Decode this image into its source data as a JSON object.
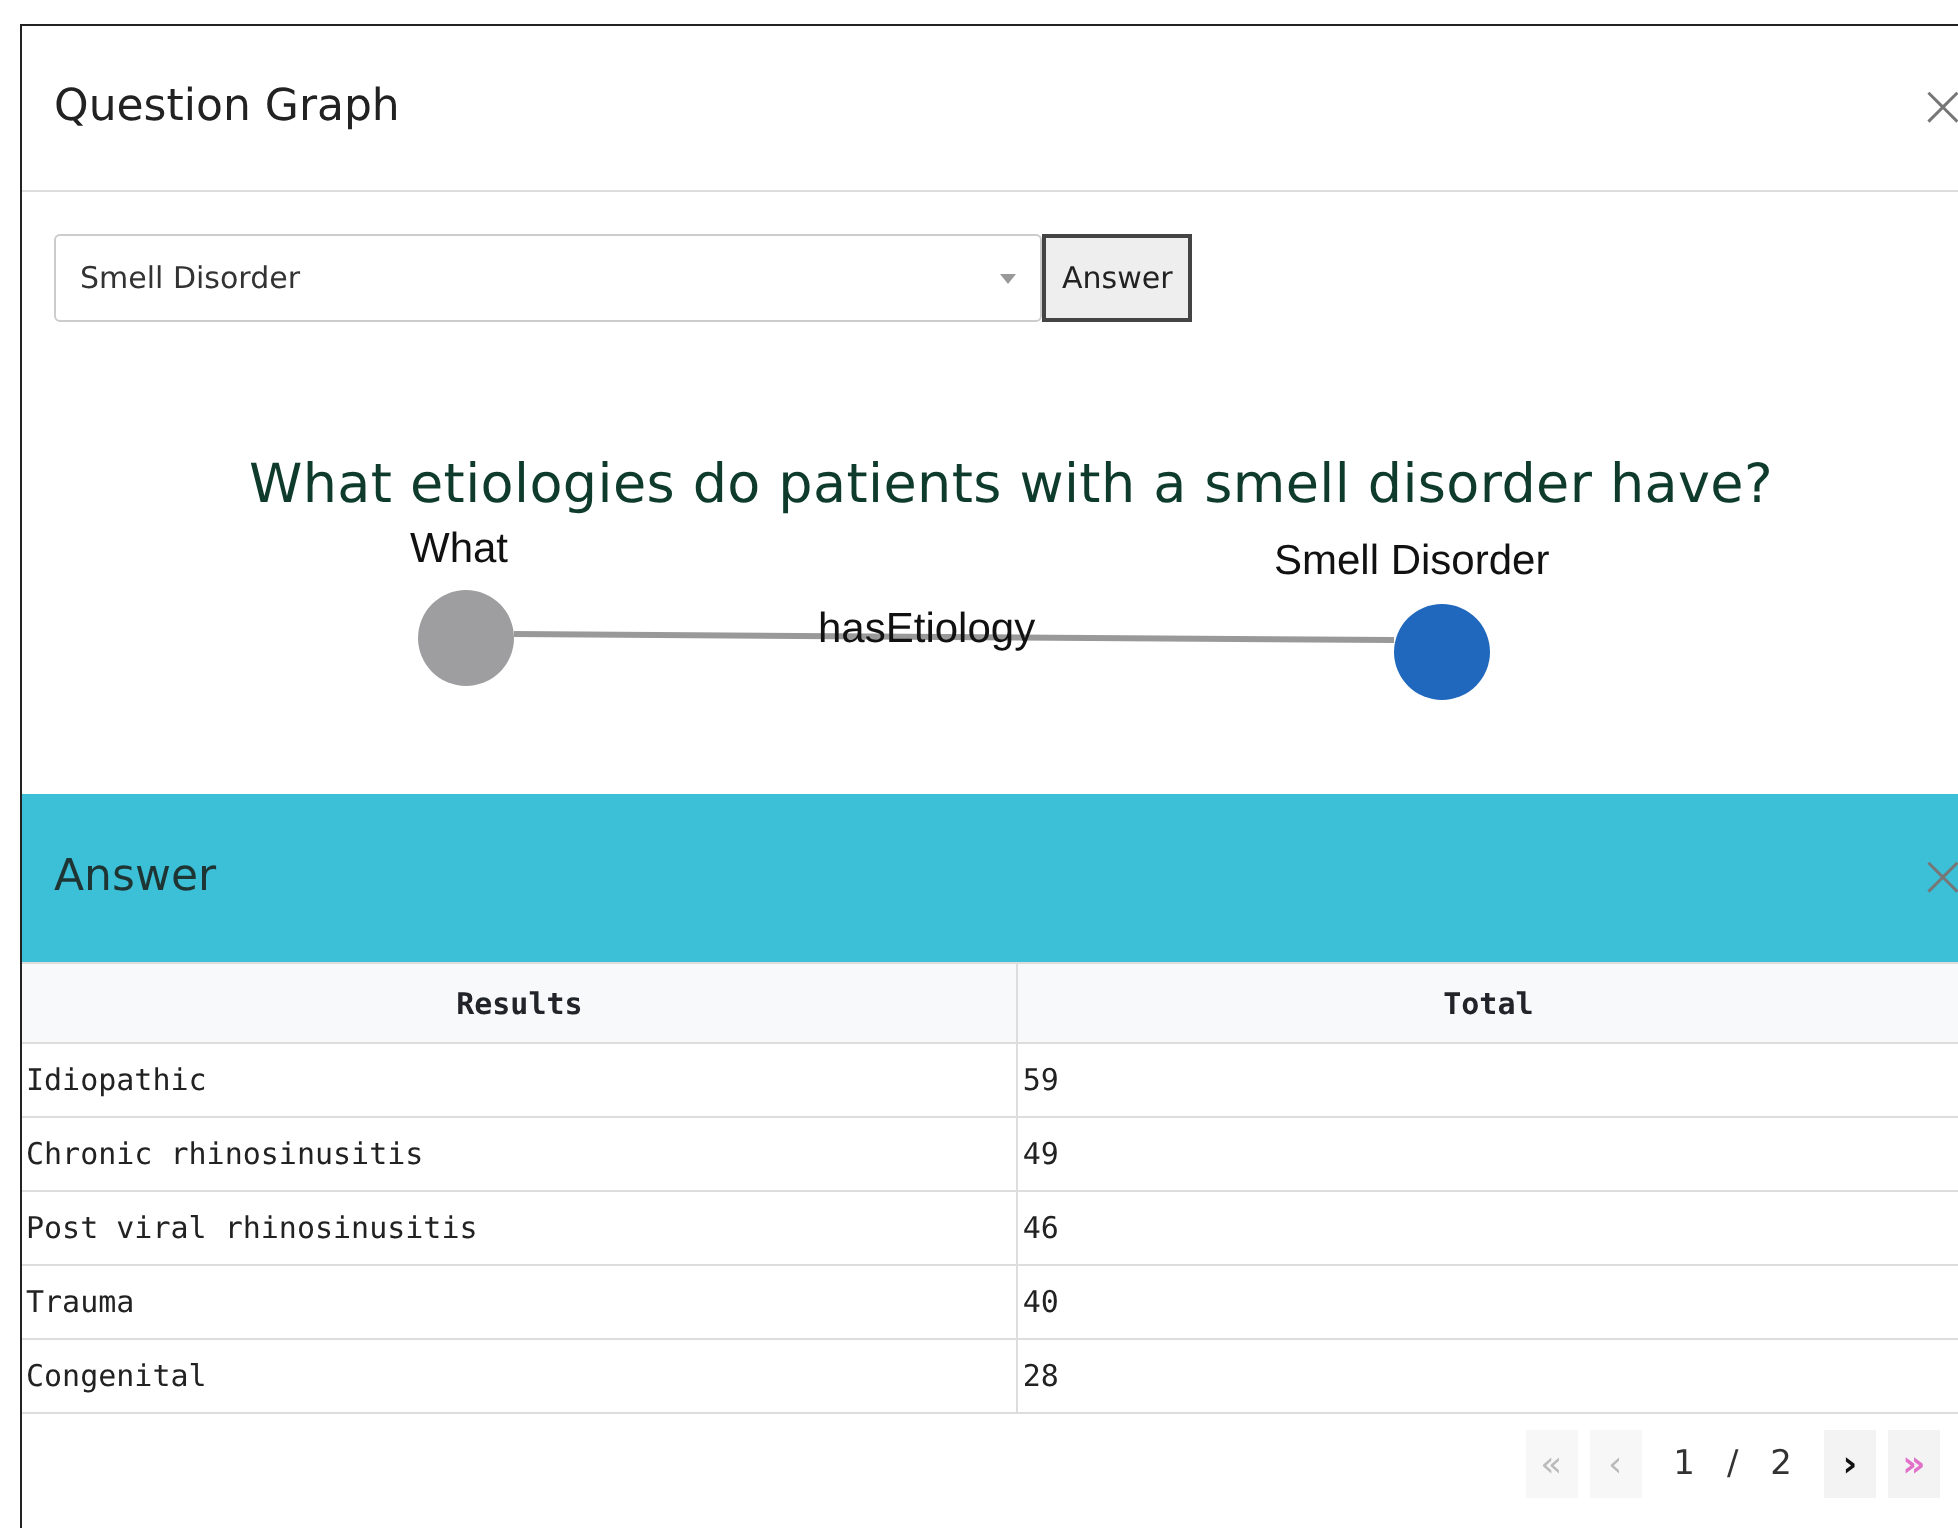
{
  "dialog": {
    "title": "Question Graph",
    "close": "×"
  },
  "query": {
    "value": "Smell Disorder",
    "button": "Answer"
  },
  "question": "What etiologies do patients with a smell disorder have?",
  "graph": {
    "nodes": [
      {
        "label": "What",
        "color": "#9e9ea0"
      },
      {
        "label": "Smell Disorder",
        "color": "#1f68bd"
      }
    ],
    "edge": "hasEtiology"
  },
  "answer": {
    "title": "Answer",
    "close": "×",
    "columns": [
      "Results",
      "Total"
    ],
    "rows": [
      [
        "Idiopathic",
        "59"
      ],
      [
        "Chronic rhinosinusitis",
        "49"
      ],
      [
        "Post viral rhinosinusitis",
        "46"
      ],
      [
        "Trauma",
        "40"
      ],
      [
        "Congenital",
        "28"
      ]
    ]
  },
  "pagination": {
    "first": {
      "label": "«",
      "disabled": true
    },
    "prev": {
      "label": "‹",
      "disabled": true
    },
    "page": "1",
    "sep": "/",
    "total": "2",
    "next": {
      "label": "›",
      "disabled": false
    },
    "last": {
      "label": "»",
      "disabled": false
    }
  }
}
